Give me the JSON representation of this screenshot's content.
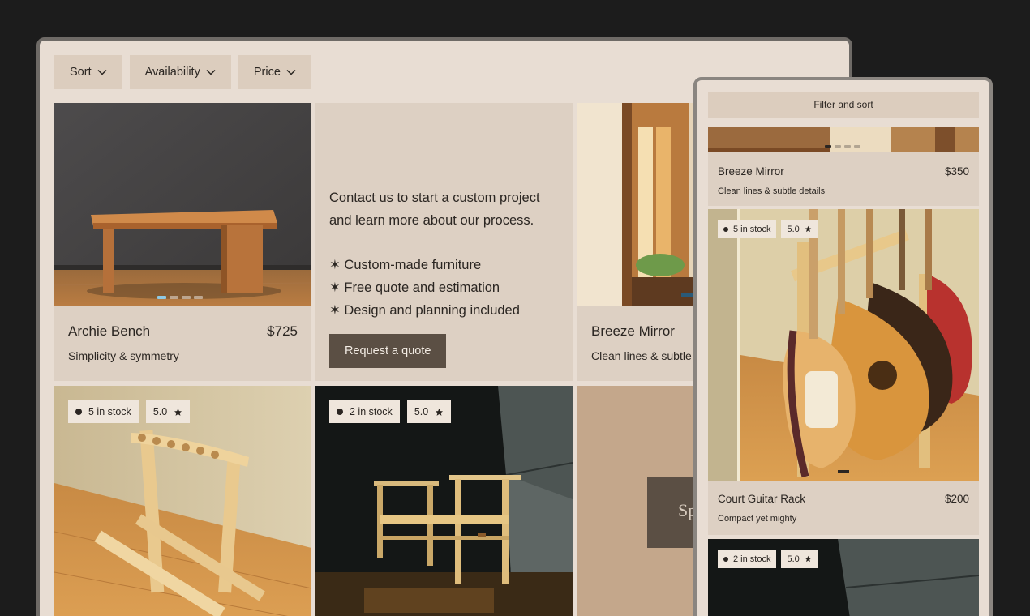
{
  "filters": [
    {
      "label": "Sort"
    },
    {
      "label": "Availability"
    },
    {
      "label": "Price"
    }
  ],
  "products": {
    "archie": {
      "name": "Archie Bench",
      "price": "$725",
      "tagline": "Simplicity & symmetry"
    },
    "breeze": {
      "name": "Breeze Mirror",
      "price": "$350",
      "tagline": "Clean lines & subtle details",
      "tagline_cut": "Clean lines & subtle"
    },
    "guitar": {
      "name": "Court Guitar Rack",
      "price": "$200",
      "tagline": "Compact yet mighty",
      "stock": "5 in stock",
      "rating": "5.0"
    },
    "chair": {
      "stock": "2 in stock",
      "rating": "5.0"
    }
  },
  "promo": {
    "intro_line1": "Contact us to start a custom project",
    "intro_line2": "and learn more about our process.",
    "bullets": [
      "✶ Custom-made furniture",
      "✶ Free quote and estimation",
      "✶ Design and planning included"
    ],
    "cta": "Request a quote"
  },
  "special_fragment": "Sp",
  "mobile": {
    "filter_label": "Filter and sort"
  },
  "icons": {
    "chevron": "chevron-down-icon",
    "star": "star-icon",
    "stock_dot": "stock-dot-icon"
  },
  "colors": {
    "page_bg": "#1c1c1c",
    "surface": "#e8ddd3",
    "card": "#ddd0c3",
    "button_dark": "#5b4f44",
    "accent_dot": "#8fc9e4"
  }
}
